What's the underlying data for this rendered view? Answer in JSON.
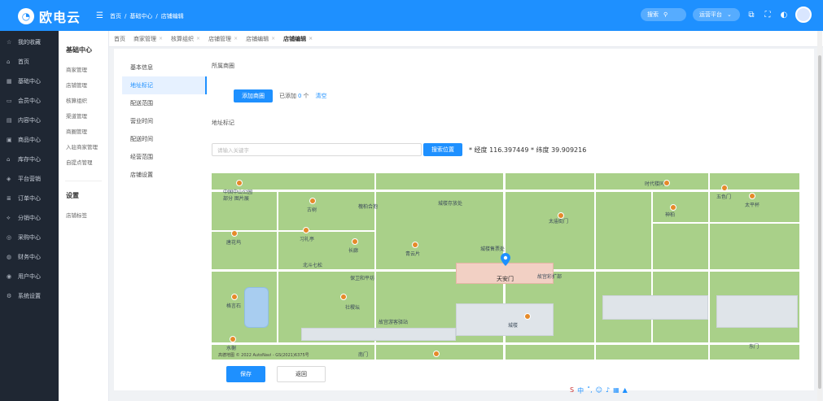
{
  "header": {
    "logo_text": "欧电云",
    "breadcrumb": [
      "首页",
      "/",
      "基础中心",
      "/",
      "店铺编辑"
    ],
    "search_label": "搜索",
    "platform_label": "运营平台"
  },
  "sidebar": {
    "items": [
      {
        "label": "我的收藏"
      },
      {
        "label": "首页"
      },
      {
        "label": "基础中心"
      },
      {
        "label": "会员中心"
      },
      {
        "label": "内容中心"
      },
      {
        "label": "商品中心"
      },
      {
        "label": "库存中心"
      },
      {
        "label": "平台营销"
      },
      {
        "label": "订单中心"
      },
      {
        "label": "分销中心"
      },
      {
        "label": "采购中心"
      },
      {
        "label": "财务中心"
      },
      {
        "label": "用户中心"
      },
      {
        "label": "系统设置"
      }
    ]
  },
  "subnav": {
    "group1_title": "基础中心",
    "group1": [
      "商家管理",
      "店铺管理",
      "核算组织",
      "渠道管理",
      "商圈管理",
      "入驻商家管理",
      "自提点管理"
    ],
    "group2_title": "设置",
    "group2": [
      "店铺标签"
    ]
  },
  "tabs": [
    {
      "label": "首页",
      "active": false
    },
    {
      "label": "商家管理",
      "active": false
    },
    {
      "label": "核算组织",
      "active": false
    },
    {
      "label": "店铺管理",
      "active": false
    },
    {
      "label": "店铺编辑",
      "active": false
    },
    {
      "label": "店铺编辑",
      "active": true
    }
  ],
  "form_nav": [
    "基本信息",
    "地址标记",
    "配送范围",
    "营业时间",
    "配送时间",
    "经营范围",
    "店铺设置"
  ],
  "form": {
    "section_title": "所属商圈",
    "add_button": "添加商圈",
    "added_prefix": "已添加",
    "added_count": "0",
    "added_suffix": "个",
    "clear": "清空",
    "address_title": "地址标记",
    "search_placeholder": "请输入关键字",
    "search_button": "搜索位置",
    "coords": "* 经度 116.397449 * 纬度 39.909216",
    "save": "保存",
    "back": "返回"
  },
  "map": {
    "labels": [
      "中国中山公园",
      "部分 图片展",
      "古树",
      "槐柏合抱",
      "城楼存放处",
      "时代楼同志",
      "五色门",
      "太平杯",
      "神柏",
      "太庙街门",
      "唐花坞",
      "习礼亭",
      "长廊",
      "青云片",
      "城楼售票处",
      "北斗七松",
      "保卫和平坊",
      "天安门",
      "故宫彩扩部",
      "社稷坛",
      "故宫游客驿站",
      "城楼",
      "格言石",
      "水榭",
      "南门",
      "东门"
    ],
    "attribution": "高德地图 © 2022 AutoNavi - GS(2021)6375号"
  },
  "colors": {
    "primary": "#1e90ff",
    "sidebar": "#1f2733",
    "map_green": "#a9d089"
  }
}
